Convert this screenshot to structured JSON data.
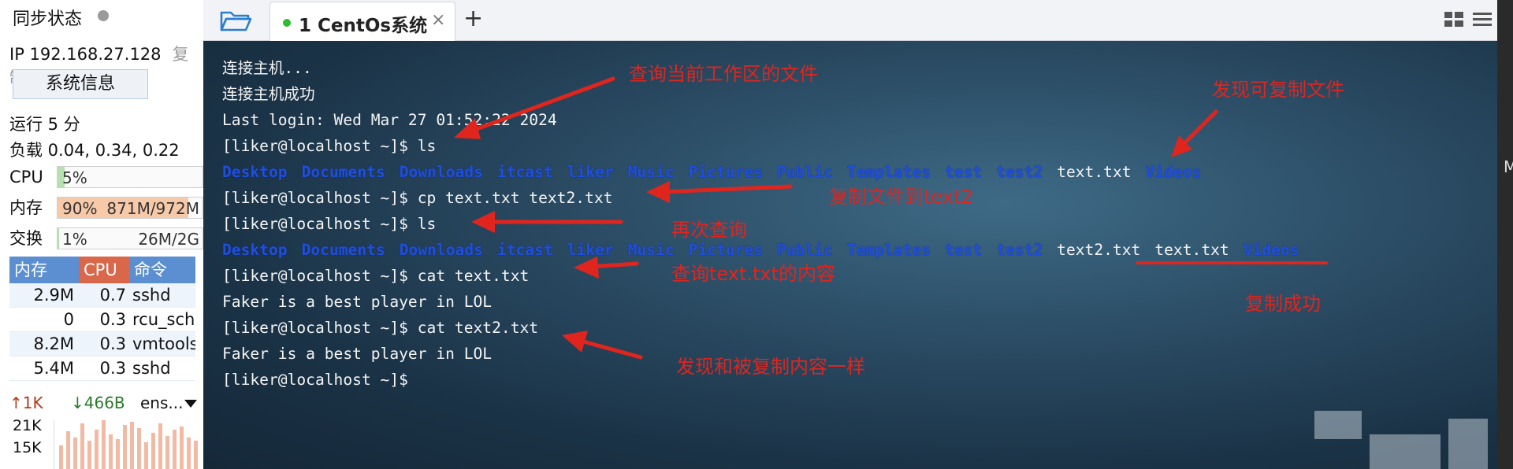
{
  "sidebar": {
    "title": "同步状态",
    "ip": "IP 192.168.27.128",
    "copy": "复制",
    "sysinfo_button": "系统信息",
    "uptime": "运行 5 分",
    "load": "负载 0.04, 0.34, 0.22",
    "cpu": {
      "label": "CPU",
      "text": "5%",
      "fraction": 0.05
    },
    "mem": {
      "label": "内存",
      "text": "90%",
      "detail": "871M/972M",
      "fraction": 0.9
    },
    "swap": {
      "label": "交换",
      "text": "1%",
      "detail": "26M/2G",
      "fraction": 0.01
    },
    "proc_headers": {
      "mem": "内存",
      "cpu": "CPU",
      "cmd": "命令"
    },
    "processes": [
      {
        "mem": "2.9M",
        "cpu": "0.7",
        "cmd": "sshd"
      },
      {
        "mem": "0",
        "cpu": "0.3",
        "cmd": "rcu_sche"
      },
      {
        "mem": "8.2M",
        "cpu": "0.3",
        "cmd": "vmtoolsc"
      },
      {
        "mem": "5.4M",
        "cpu": "0.3",
        "cmd": "sshd"
      }
    ],
    "net": {
      "up": "↑1K",
      "down": "↓466B",
      "iface": "ens...",
      "scale1": "21K",
      "scale2": "15K"
    }
  },
  "tabs": {
    "active_label": "1 CentOs系统",
    "close": "×",
    "new": "+"
  },
  "terminal": {
    "l1": "连接主机...",
    "l2": "连接主机成功",
    "l3": "Last login: Wed Mar 27 01:52:22 2024",
    "prompt": "[liker@localhost ~]$ ",
    "cmd_ls": "ls",
    "cmd_cp": "cp text.txt text2.txt",
    "cmd_cat1": "cat text.txt",
    "cmd_cat2": "cat text2.txt",
    "out_faker": "Faker is a best player in LOL",
    "ls1": {
      "dirs_a": [
        "Desktop",
        "Documents",
        "Downloads",
        "itcast",
        "liker",
        "Music",
        "Pictures",
        "Public",
        "Templates",
        "test",
        "test2"
      ],
      "file": "text.txt",
      "dir_end": "Videos"
    },
    "ls2": {
      "dirs_a": [
        "Desktop",
        "Documents",
        "Downloads",
        "itcast",
        "liker",
        "Music",
        "Pictures",
        "Public",
        "Templates",
        "test",
        "test2"
      ],
      "files": [
        "text2.txt",
        "text.txt"
      ],
      "dir_end": "Videos"
    }
  },
  "annotations": {
    "a1": "查询当前工作区的文件",
    "a2": "发现可复制文件",
    "a3": "复制文件到text2",
    "a4": "再次查询",
    "a5": "查询text.txt的内容",
    "a6": "复制成功",
    "a7": "发现和被复制内容一样",
    "color": "#e0251e"
  },
  "right_edge_letter": "M"
}
